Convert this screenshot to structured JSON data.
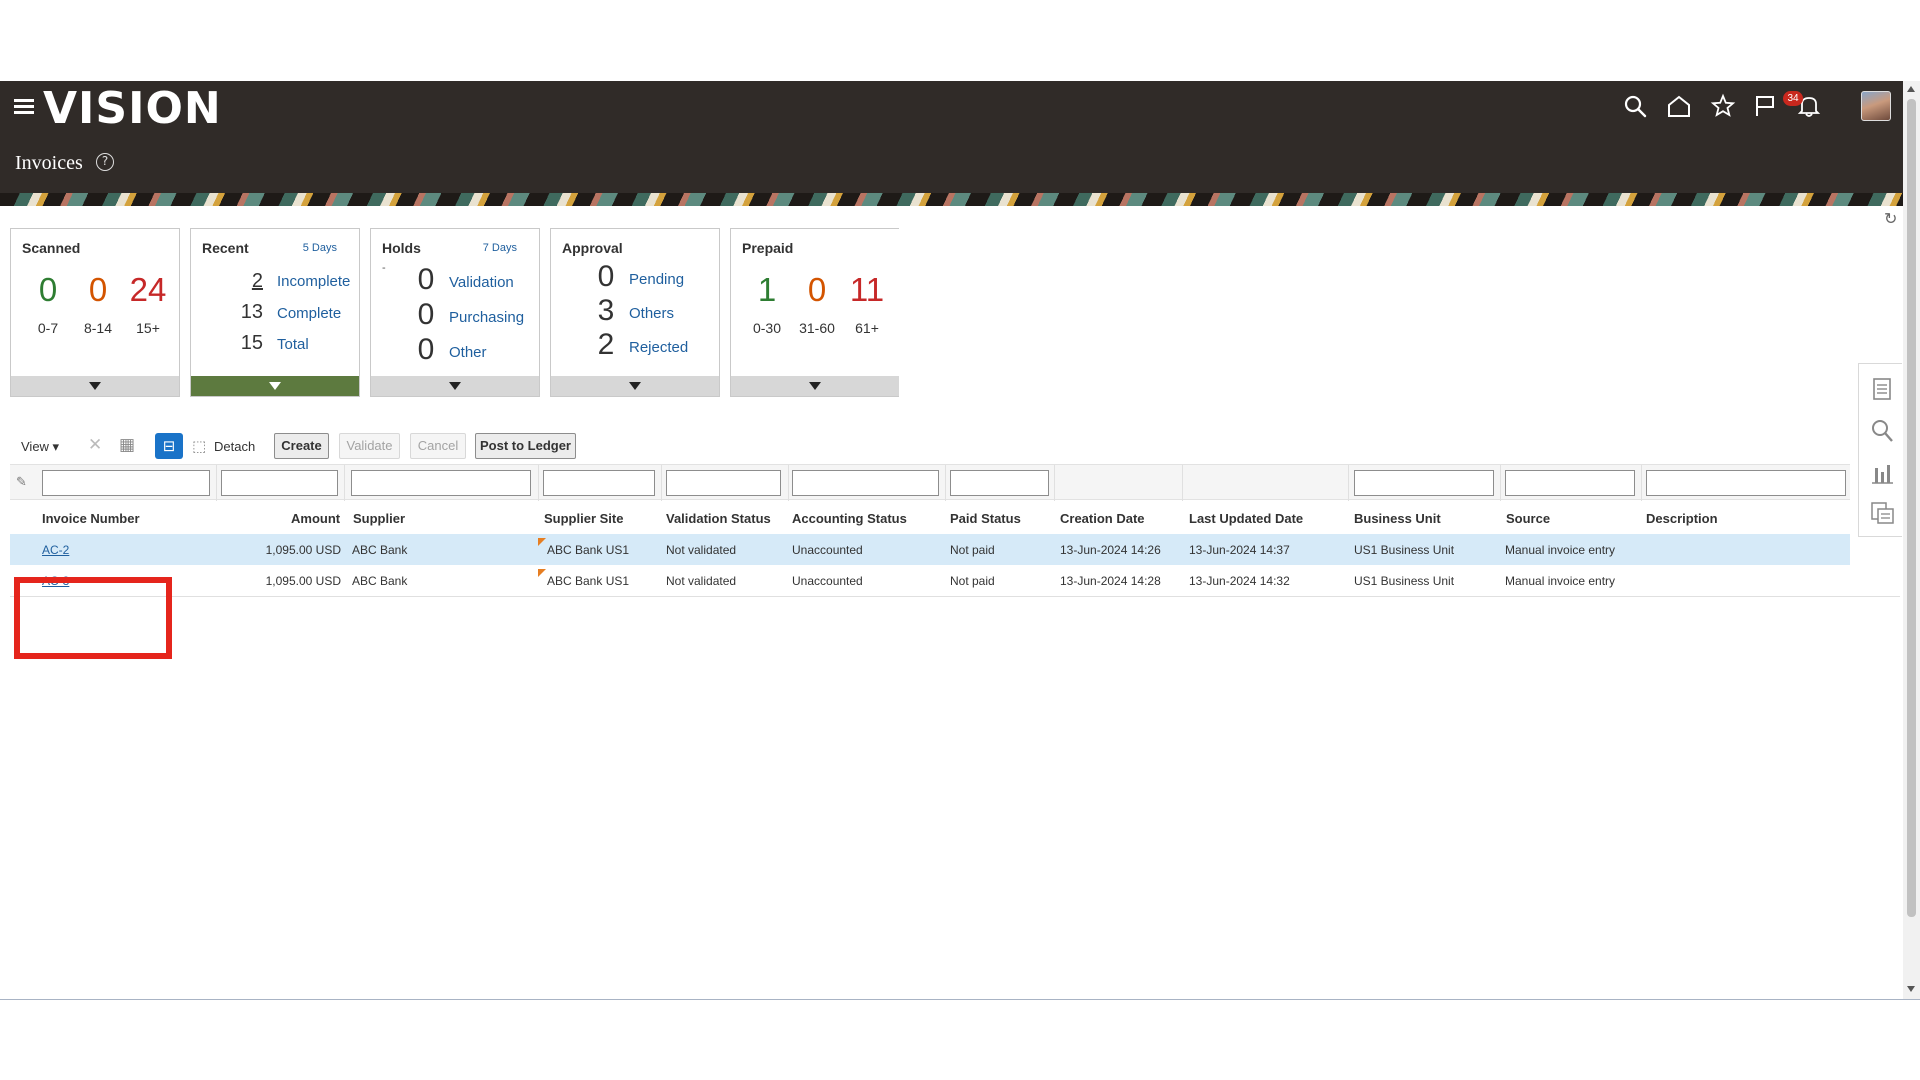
{
  "app": {
    "logo": "VISION",
    "page_title": "Invoices",
    "help_glyph": "?",
    "notification_count": "34"
  },
  "header_icons": [
    "search-icon",
    "home-icon",
    "favorites-star-icon",
    "flag-icon",
    "notifications-bell-icon"
  ],
  "tiles": {
    "scanned": {
      "title": "Scanned",
      "buckets": [
        {
          "value": "0",
          "label": "0-7",
          "color": "#2e7d32"
        },
        {
          "value": "0",
          "label": "8-14",
          "color": "#d35400"
        },
        {
          "value": "24",
          "label": "15+",
          "color": "#c62828"
        }
      ]
    },
    "recent": {
      "title": "Recent",
      "subtitle": "5 Days",
      "items": [
        {
          "value": "2",
          "label": "Incomplete"
        },
        {
          "value": "13",
          "label": "Complete"
        },
        {
          "value": "15",
          "label": "Total"
        }
      ]
    },
    "holds": {
      "title": "Holds",
      "subtitle": "7 Days",
      "dash": "-",
      "items": [
        {
          "value": "0",
          "label": "Validation"
        },
        {
          "value": "0",
          "label": "Purchasing"
        },
        {
          "value": "0",
          "label": "Other"
        }
      ]
    },
    "approval": {
      "title": "Approval",
      "items": [
        {
          "value": "0",
          "label": "Pending"
        },
        {
          "value": "3",
          "label": "Others"
        },
        {
          "value": "2",
          "label": "Rejected"
        }
      ]
    },
    "prepaid": {
      "title": "Prepaid",
      "buckets": [
        {
          "value": "1",
          "label": "0-30",
          "color": "#2e7d32"
        },
        {
          "value": "0",
          "label": "31-60",
          "color": "#d35400"
        },
        {
          "value": "11",
          "label": "61+",
          "color": "#c62828"
        }
      ]
    }
  },
  "toolbar": {
    "view_label": "View ▾",
    "detach_label": "Detach",
    "create_label": "Create",
    "validate_label": "Validate",
    "cancel_label": "Cancel",
    "post_label": "Post to Ledger"
  },
  "table": {
    "columns": [
      "Invoice Number",
      "Amount",
      "Supplier",
      "Supplier Site",
      "Validation Status",
      "Accounting Status",
      "Paid Status",
      "Creation Date",
      "Last Updated Date",
      "Business Unit",
      "Source",
      "Description"
    ],
    "rows": [
      [
        "AC-2",
        "1,095.00 USD",
        "ABC Bank",
        "ABC Bank US1",
        "Not validated",
        "Unaccounted",
        "Not paid",
        "13-Jun-2024 14:26",
        "13-Jun-2024 14:37",
        "US1 Business Unit",
        "Manual invoice entry",
        ""
      ],
      [
        "AC-3",
        "1,095.00 USD",
        "ABC Bank",
        "ABC Bank US1",
        "Not validated",
        "Unaccounted",
        "Not paid",
        "13-Jun-2024 14:28",
        "13-Jun-2024 14:32",
        "US1 Business Unit",
        "Manual invoice entry",
        ""
      ]
    ]
  },
  "colors": {
    "header_bg": "#302b28",
    "link": "#1f5f9e",
    "active_tile": "#5d7a3f",
    "highlight": "#e5251c",
    "chat": "#d8392b"
  }
}
